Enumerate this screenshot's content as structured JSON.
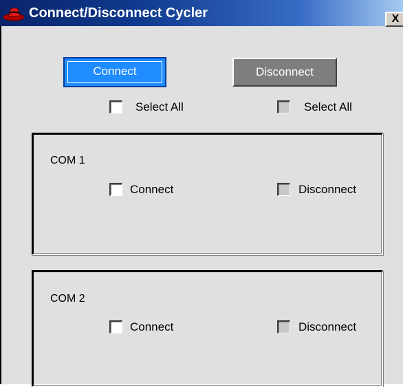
{
  "window": {
    "title": "Connect/Disconnect Cycler",
    "close_glyph": "X",
    "app_icon": "red-hat-icon"
  },
  "actions": {
    "connect_label": "Connect",
    "disconnect_label": "Disconnect",
    "connect_color": "#1f8cff",
    "disconnect_color": "#7e7e7e"
  },
  "select_all": {
    "connect_label": "Select All",
    "disconnect_label": "Select All",
    "connect_checked": false,
    "disconnect_checked": false,
    "disconnect_enabled": false
  },
  "ports": [
    {
      "name": "COM 1",
      "connect_label": "Connect",
      "disconnect_label": "Disconnect",
      "connect_checked": false,
      "disconnect_checked": false,
      "disconnect_enabled": false
    },
    {
      "name": "COM 2",
      "connect_label": "Connect",
      "disconnect_label": "Disconnect",
      "connect_checked": false,
      "disconnect_checked": false,
      "disconnect_enabled": false
    }
  ]
}
